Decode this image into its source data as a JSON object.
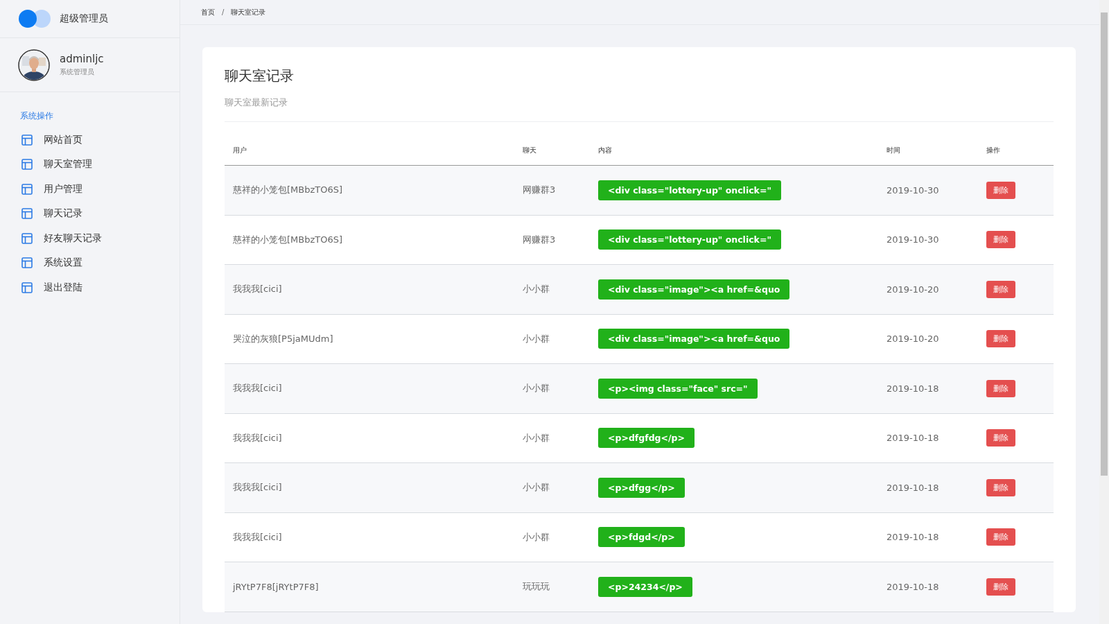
{
  "sidebar": {
    "brand": "超级管理员",
    "user": {
      "name": "adminljc",
      "role": "系统管理员"
    },
    "section_title": "系统操作",
    "items": [
      {
        "label": "网站首页",
        "selected": false
      },
      {
        "label": "聊天室管理",
        "selected": false
      },
      {
        "label": "用户管理",
        "selected": false
      },
      {
        "label": "聊天记录",
        "selected": false
      },
      {
        "label": "好友聊天记录",
        "selected": false
      },
      {
        "label": "系统设置",
        "selected": false
      },
      {
        "label": "退出登陆",
        "selected": false
      }
    ]
  },
  "breadcrumb": {
    "items": [
      "首页",
      "聊天室记录"
    ],
    "separator": "/"
  },
  "card": {
    "title": "聊天室记录",
    "subtitle": "聊天室最新记录"
  },
  "table": {
    "columns": [
      "用户",
      "聊天",
      "内容",
      "时间",
      "操作"
    ],
    "rows": [
      {
        "user": "慈祥的小笼包[MBbzTO6S]",
        "chat": "网赚群3",
        "content": "<div class=\"lottery-up\" onclick=\"",
        "time": "2019-10-30",
        "action": "删除"
      },
      {
        "user": "慈祥的小笼包[MBbzTO6S]",
        "chat": "网赚群3",
        "content": "<div class=\"lottery-up\" onclick=\"",
        "time": "2019-10-30",
        "action": "删除"
      },
      {
        "user": "我我我[cici]",
        "chat": "小小群",
        "content": "<div class=\"image\"><a href=&quo",
        "time": "2019-10-20",
        "action": "删除"
      },
      {
        "user": "哭泣的灰狼[P5jaMUdm]",
        "chat": "小小群",
        "content": "<div class=\"image\"><a href=&quo",
        "time": "2019-10-20",
        "action": "删除"
      },
      {
        "user": "我我我[cici]",
        "chat": "小小群",
        "content": "<p><img class=\"face\" src=\"",
        "time": "2019-10-18",
        "action": "删除"
      },
      {
        "user": "我我我[cici]",
        "chat": "小小群",
        "content": "<p>dfgfdg</p>",
        "time": "2019-10-18",
        "action": "删除"
      },
      {
        "user": "我我我[cici]",
        "chat": "小小群",
        "content": "<p>dfgg</p>",
        "time": "2019-10-18",
        "action": "删除"
      },
      {
        "user": "我我我[cici]",
        "chat": "小小群",
        "content": "<p>fdgd</p>",
        "time": "2019-10-18",
        "action": "删除"
      },
      {
        "user": "jRYtP7F8[jRYtP7F8]",
        "chat": "玩玩玩",
        "content": "<p>24234</p>",
        "time": "2019-10-18",
        "action": "删除"
      }
    ]
  }
}
